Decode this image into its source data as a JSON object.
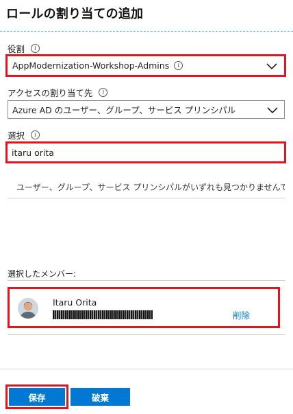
{
  "header": {
    "title": "ロールの割り当ての追加"
  },
  "role": {
    "label": "役割",
    "info_icon": "info-icon",
    "value": "AppModernization-Workshop-Admins",
    "chevron_icon": "chevron-down-icon"
  },
  "assign_to": {
    "label": "アクセスの割り当て先",
    "info_icon": "info-icon",
    "value": "Azure AD のユーザー、グループ、サービス プリンシパル",
    "chevron_icon": "chevron-down-icon"
  },
  "select": {
    "label": "選択",
    "info_icon": "info-icon",
    "value": "itaru orita"
  },
  "search_result": {
    "message": "ユーザー、グループ、サービス プリンシパルがいずれも見つかりませんでし..."
  },
  "selected_members": {
    "label": "選択したメンバー:",
    "items": [
      {
        "name": "Itaru Orita",
        "remove_label": "削除"
      }
    ]
  },
  "footer": {
    "save_label": "保存",
    "discard_label": "破棄"
  },
  "colors": {
    "accent": "#0078d4",
    "highlight": "#e4141e",
    "divider": "#3fb6c8"
  }
}
